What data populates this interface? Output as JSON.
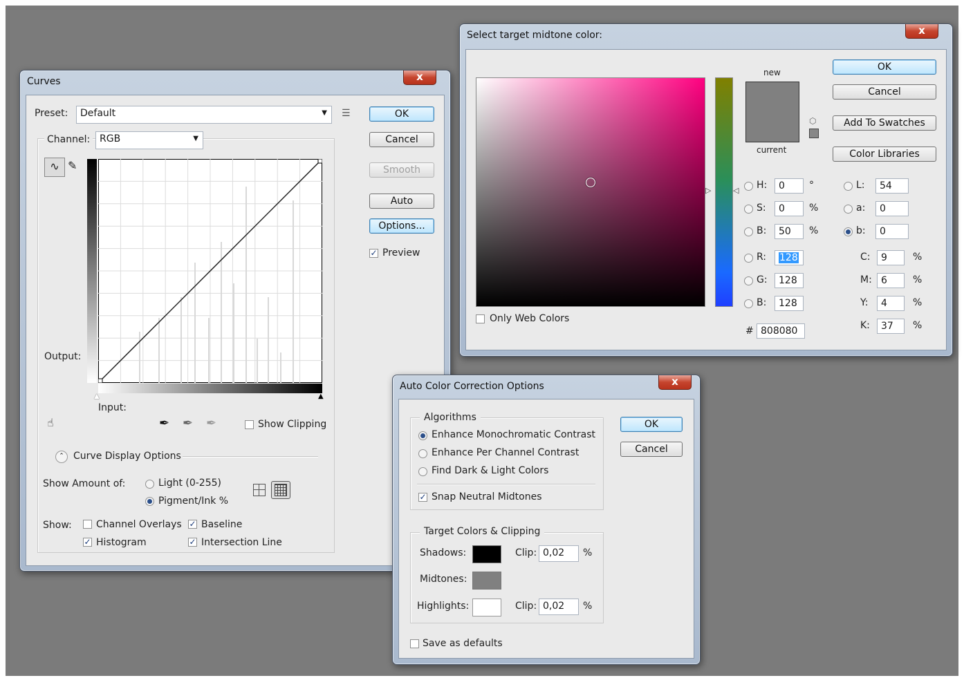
{
  "curves": {
    "title": "Curves",
    "close": "x",
    "preset_label": "Preset:",
    "preset_value": "Default",
    "channel_label": "Channel:",
    "channel_value": "RGB",
    "ok": "OK",
    "cancel": "Cancel",
    "smooth": "Smooth",
    "auto": "Auto",
    "options": "Options...",
    "preview": "Preview",
    "output_label": "Output:",
    "input_label": "Input:",
    "show_clipping": "Show Clipping",
    "curve_display_options": "Curve Display Options",
    "show_amount_label": "Show Amount of:",
    "light_label": "Light  (0-255)",
    "pigment_label": "Pigment/Ink %",
    "show_label": "Show:",
    "channel_overlays": "Channel Overlays",
    "baseline": "Baseline",
    "histogram": "Histogram",
    "intersection_line": "Intersection Line"
  },
  "picker": {
    "title": "Select target midtone color:",
    "close": "x",
    "new_label": "new",
    "current_label": "current",
    "ok": "OK",
    "cancel": "Cancel",
    "add_swatches": "Add To Swatches",
    "color_libraries": "Color Libraries",
    "only_web": "Only Web Colors",
    "hash": "#",
    "hex": "808080",
    "swatch_color": "#808080",
    "fields": [
      {
        "label": "H:",
        "value": "0",
        "unit": "°"
      },
      {
        "label": "S:",
        "value": "0",
        "unit": "%"
      },
      {
        "label": "B:",
        "value": "50",
        "unit": "%"
      },
      {
        "label": "R:",
        "value": "128",
        "unit": ""
      },
      {
        "label": "G:",
        "value": "128",
        "unit": ""
      },
      {
        "label": "B:",
        "value": "128",
        "unit": ""
      }
    ],
    "lab": [
      {
        "label": "L:",
        "value": "54"
      },
      {
        "label": "a:",
        "value": "0"
      },
      {
        "label": "b:",
        "value": "0"
      }
    ],
    "cmyk": [
      {
        "label": "C:",
        "value": "9",
        "unit": "%"
      },
      {
        "label": "M:",
        "value": "6",
        "unit": "%"
      },
      {
        "label": "Y:",
        "value": "4",
        "unit": "%"
      },
      {
        "label": "K:",
        "value": "37",
        "unit": "%"
      }
    ]
  },
  "autocolor": {
    "title": "Auto Color Correction Options",
    "close": "x",
    "algorithms": "Algorithms",
    "opt1": "Enhance Monochromatic Contrast",
    "opt2": "Enhance Per Channel Contrast",
    "opt3": "Find Dark & Light Colors",
    "snap": "Snap Neutral Midtones",
    "target": "Target Colors & Clipping",
    "shadows": "Shadows:",
    "midtones": "Midtones:",
    "highlights": "Highlights:",
    "clip": "Clip:",
    "shadow_clip": "0,02",
    "highlight_clip": "0,02",
    "pct": "%",
    "save_defaults": "Save as defaults",
    "ok": "OK",
    "cancel": "Cancel",
    "shadow_color": "#000000",
    "midtone_color": "#808080",
    "highlight_color": "#ffffff"
  }
}
